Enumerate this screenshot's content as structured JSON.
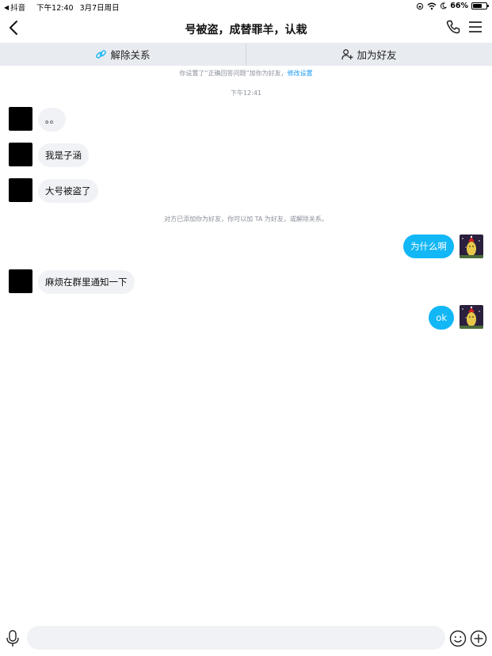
{
  "status_bar": {
    "back_app": "抖音",
    "time": "下午12:40",
    "date": "3月7日周日",
    "battery": "66%",
    "battery_level": 0.66
  },
  "navbar": {
    "title": "号被盗，成替罪羊，认栽"
  },
  "actions": {
    "remove_relation": "解除关系",
    "add_friend": "加为好友"
  },
  "system_notes": {
    "setting_prefix": "你设置了“正确回答问题”加你为好友，",
    "setting_link": "修改设置",
    "time_1": "下午12:41",
    "friend_notice": "对方已添加你为好友，你可以加 TA 为好友，或解除关系。"
  },
  "messages": [
    {
      "side": "in",
      "text": "。。"
    },
    {
      "side": "in",
      "text": "我是子涵"
    },
    {
      "side": "in",
      "text": "大号被盗了"
    },
    {
      "side": "out",
      "text": "为什么啊"
    },
    {
      "side": "in",
      "text": "麻烦在群里通知一下"
    },
    {
      "side": "out",
      "text": "ok"
    }
  ],
  "input": {
    "placeholder": ""
  },
  "colors": {
    "accent": "#12b7f5",
    "link": "#1a9af5",
    "action_bar": "#e8ebf0",
    "incoming_bubble": "#f1f2f5"
  }
}
